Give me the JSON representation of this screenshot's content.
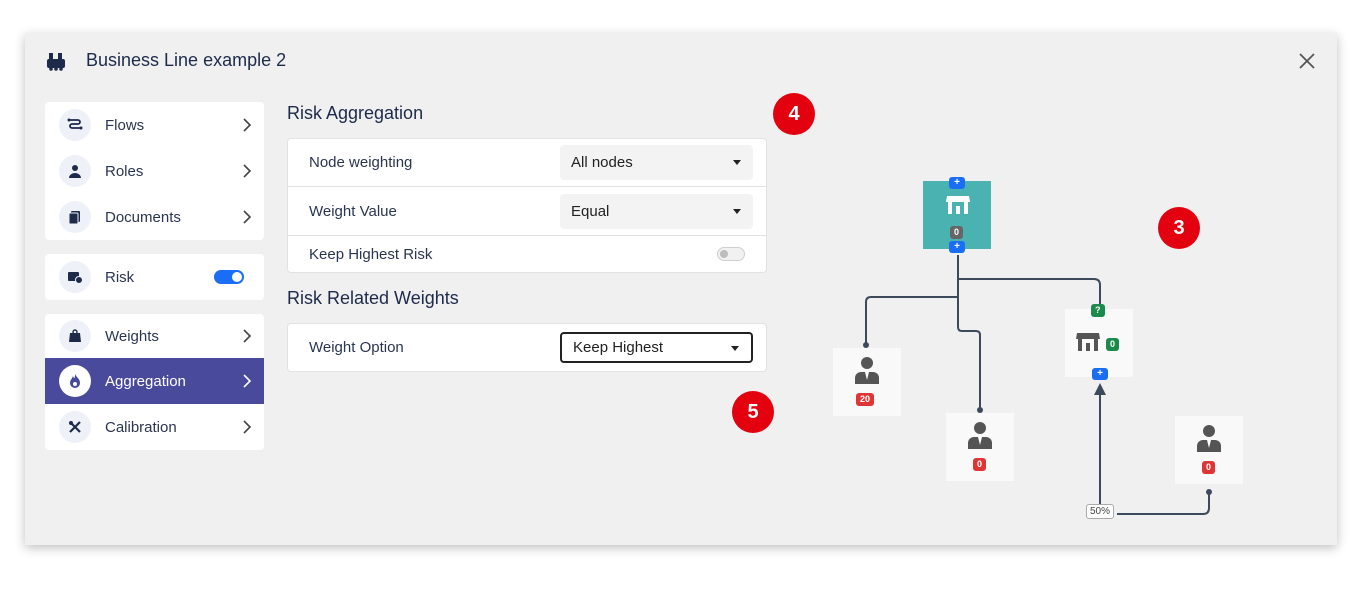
{
  "header": {
    "title": "Business Line example 2"
  },
  "nav": {
    "group1": [
      {
        "label": "Flows",
        "icon": "flows-icon"
      },
      {
        "label": "Roles",
        "icon": "roles-icon"
      },
      {
        "label": "Documents",
        "icon": "documents-icon"
      }
    ],
    "risk": {
      "label": "Risk",
      "toggle_on": true
    },
    "group2": [
      {
        "label": "Weights",
        "icon": "weights-icon"
      },
      {
        "label": "Aggregation",
        "icon": "aggregation-icon",
        "active": true
      },
      {
        "label": "Calibration",
        "icon": "calibration-icon"
      }
    ]
  },
  "risk_aggregation": {
    "heading": "Risk Aggregation",
    "node_weighting": {
      "label": "Node weighting",
      "value": "All nodes"
    },
    "weight_value": {
      "label": "Weight Value",
      "value": "Equal"
    },
    "keep_highest": {
      "label": "Keep Highest Risk",
      "on": false
    }
  },
  "risk_related": {
    "heading": "Risk Related Weights",
    "weight_option": {
      "label": "Weight Option",
      "value": "Keep Highest"
    }
  },
  "markers": {
    "m4": "4",
    "m3": "3",
    "m5": "5"
  },
  "graph": {
    "root_count": "0",
    "role_a_count": "20",
    "role_b_count": "0",
    "store_badge": "?",
    "store_count": "0",
    "role_c_count": "0",
    "plus": "+",
    "percent": "50%"
  },
  "colors": {
    "accent": "#4a4a9c",
    "toggle": "#1a6ef5",
    "marker": "#e3000f",
    "root_node": "#4bb2b2"
  }
}
